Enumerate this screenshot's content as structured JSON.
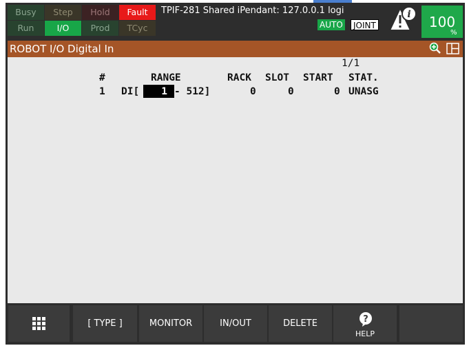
{
  "status_panel": {
    "row1": [
      {
        "label": "Busy",
        "bg": "#28432f",
        "fg": "#8aa48f"
      },
      {
        "label": "Step",
        "bg": "#3a3628",
        "fg": "#8f8a72"
      },
      {
        "label": "Hold",
        "bg": "#3c2223",
        "fg": "#9c7778"
      },
      {
        "label": "Fault",
        "bg": "#e81919",
        "fg": "#ffffff"
      }
    ],
    "row2": [
      {
        "label": "Run",
        "bg": "#28432f",
        "fg": "#8aa48f"
      },
      {
        "label": "I/O",
        "bg": "#18a648",
        "fg": "#ffffff"
      },
      {
        "label": "Prod",
        "bg": "#28432f",
        "fg": "#8aa48f"
      },
      {
        "label": "TCyc",
        "bg": "#3a3628",
        "fg": "#8f8a72"
      }
    ]
  },
  "header": {
    "title": "TPIF-281 Shared iPendant: 127.0.0.1 logi",
    "mode_badge": "AUTO",
    "coord_badge": "JOINT",
    "speed_value": "100",
    "speed_unit": "%"
  },
  "menu": {
    "title": "ROBOT I/O Digital In",
    "zoom_icon": "zoom-in-icon",
    "split_icon": "window-split-icon"
  },
  "table": {
    "page_indicator": "1/1",
    "columns": [
      "#",
      "RANGE",
      "RACK",
      "SLOT",
      "START",
      "STAT."
    ],
    "rows": [
      {
        "num": "1",
        "prefix": "DI[",
        "range_start": "   1",
        "range_end": "- 512]",
        "rack": "0",
        "slot": "0",
        "start": "0",
        "stat": "UNASG"
      }
    ]
  },
  "footer": {
    "buttons": [
      "[ TYPE ]",
      "MONITOR",
      "IN/OUT",
      "DELETE",
      "HELP",
      ""
    ],
    "menu_icon": "grid-menu-icon",
    "help_icon": "help-icon"
  },
  "colors": {
    "menubar": "#a55527",
    "content_bg": "#e9e9e9",
    "frame": "#2d2d2d",
    "button_bg": "#3b3b3b",
    "speed_bg": "#1fa84a"
  }
}
